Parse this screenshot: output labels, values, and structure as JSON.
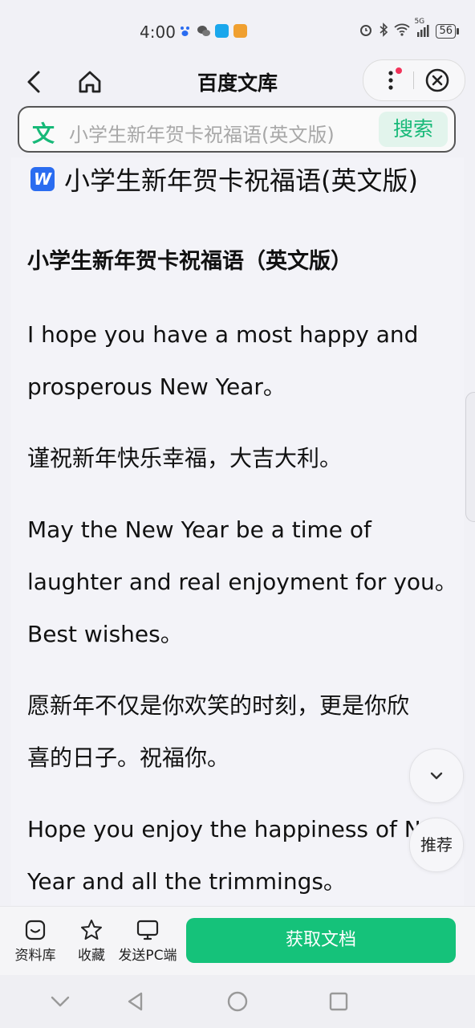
{
  "status": {
    "time": "4:00",
    "network": "5G",
    "battery": "56"
  },
  "header": {
    "title": "百度文库"
  },
  "search": {
    "logo": "文",
    "query": "小学生新年贺卡祝福语(英文版)",
    "button_label": "搜索"
  },
  "document": {
    "title": "小学生新年贺卡祝福语(英文版)",
    "heading": "小学生新年贺卡祝福语（英文版）",
    "paragraphs": [
      [
        "I hope you have a most happy and",
        "prosperous New Year。"
      ],
      [
        "谨祝新年快乐幸福，大吉大利。"
      ],
      [
        "May the New Year be a time of",
        "laughter and real enjoyment for you。",
        "Best wishes。"
      ],
      [
        "愿新年不仅是你欢笑的时刻，更是你欣",
        "喜的日子。祝福你。"
      ],
      [
        "Hope you enjoy the happiness of New",
        "Year and all the trimmings。"
      ]
    ]
  },
  "floating": {
    "expand_icon": "chevron-down-icon",
    "recommend_label": "推荐"
  },
  "bottom_bar": {
    "library_label": "资料库",
    "favorite_label": "收藏",
    "send_pc_label": "发送PC端",
    "get_doc_label": "获取文档"
  },
  "colors": {
    "accent": "#15c27a",
    "search_accent": "#17b978",
    "word_icon": "#2a6cf0"
  }
}
